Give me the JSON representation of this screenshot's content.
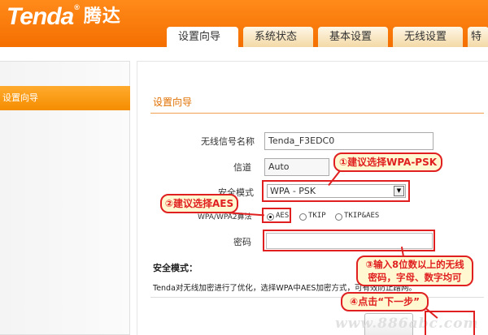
{
  "brand": {
    "name": "Tenda",
    "registered": "®",
    "chinese_name": "腾达",
    "header_color": "#f57a00"
  },
  "tabs": [
    {
      "label": "设置向导",
      "active": true
    },
    {
      "label": "系统状态",
      "active": false
    },
    {
      "label": "基本设置",
      "active": false
    },
    {
      "label": "无线设置",
      "active": false
    },
    {
      "label": "特",
      "active": false
    }
  ],
  "sidebar": {
    "items": [
      {
        "label": "设置向导",
        "selected": true
      }
    ]
  },
  "main": {
    "title": "设置向导",
    "ssid": {
      "label": "无线信号名称",
      "value": "Tenda_F3EDC0"
    },
    "channel": {
      "label": "信道",
      "value": "Auto"
    },
    "security_mode": {
      "label": "安全模式",
      "value": "WPA - PSK",
      "arrow_icon": "dropdown-arrow-icon"
    },
    "algorithm": {
      "label": "WPA/WPA2算法",
      "options": [
        {
          "label": "AES",
          "checked": true
        },
        {
          "label": "TKIP",
          "checked": false
        },
        {
          "label": "TKIP&AES",
          "checked": false
        }
      ]
    },
    "password": {
      "label": "密码",
      "value": ""
    },
    "security_heading": "安全模式：",
    "security_desc": "Tenda对无线加密进行了优化，选择WPA中AES加密方式，可有效防止蹭网。"
  },
  "annotations": {
    "note1": "①建议选择WPA-PSK",
    "note2": "②建议选择AES",
    "note3_line1": "③输入8位数以上的无线",
    "note3_line2": "密码，字母、数字均可",
    "note4": "④点击“下一步”",
    "color": "#e02020"
  },
  "watermark": "www.886abc.com"
}
